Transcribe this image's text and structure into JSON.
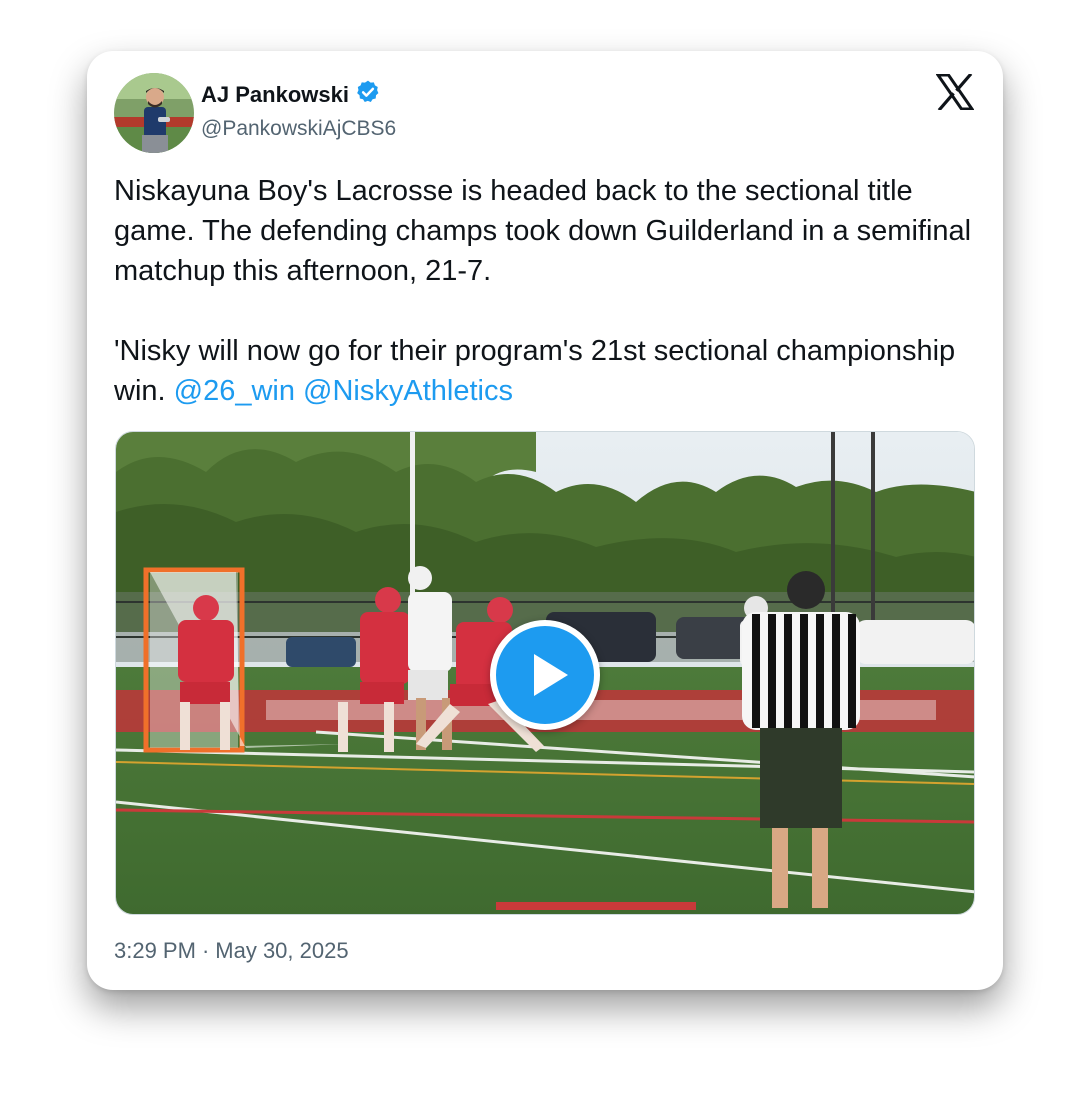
{
  "author": {
    "display_name": "AJ Pankowski",
    "handle": "@PankowskiAjCBS6",
    "verified": true,
    "verified_badge_color": "#1d9bf0"
  },
  "platform_icon": "x-logo-icon",
  "tweet": {
    "paragraph1": "Niskayuna Boy's Lacrosse is headed back to the sectional title game. The defending champs took down Guilderland in a semifinal matchup this afternoon, 21-7.",
    "paragraph2_text": "'Nisky will now go for their program's 21st sectional championship win. ",
    "mentions": [
      "@26_win",
      "@NiskyAthletics"
    ],
    "mention_color": "#1d9bf0"
  },
  "media": {
    "type": "video",
    "play_icon": "play-icon"
  },
  "footer": {
    "time": "3:29 PM",
    "separator": "·",
    "date": "May 30, 2025"
  }
}
